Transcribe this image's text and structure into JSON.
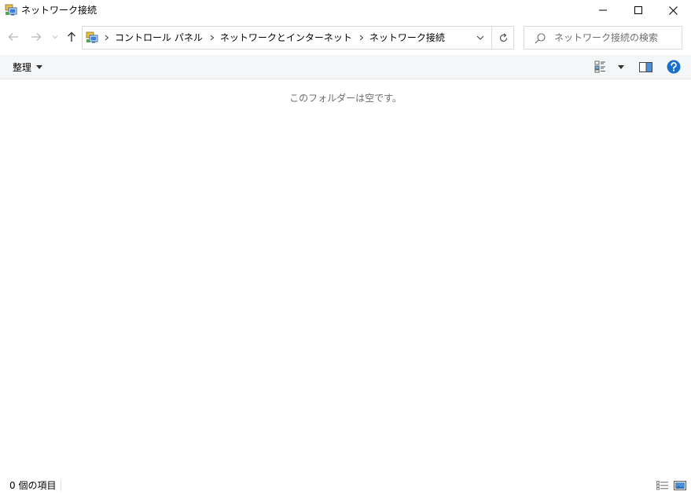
{
  "window": {
    "title": "ネットワーク接続",
    "app_icon": "network-connections-icon",
    "controls": {
      "minimize_icon": "minimize-icon",
      "maximize_icon": "maximize-icon",
      "close_icon": "close-icon"
    }
  },
  "navigation": {
    "back_icon": "arrow-left-icon",
    "forward_icon": "arrow-right-icon",
    "recent_icon": "chevron-down-icon",
    "up_icon": "arrow-up-icon",
    "breadcrumbs": [
      "コントロール パネル",
      "ネットワークとインターネット",
      "ネットワーク接続"
    ],
    "refresh_icon": "refresh-icon"
  },
  "search": {
    "placeholder": "ネットワーク接続の検索"
  },
  "commandbar": {
    "organize_label": "整理",
    "view_icon": "change-view-icon",
    "preview_pane_icon": "preview-pane-icon",
    "help_icon": "help-icon"
  },
  "content": {
    "empty_message": "このフォルダーは空です。"
  },
  "statusbar": {
    "item_count": "0 個の項目",
    "details_view_icon": "details-view-icon",
    "large_icons_view_icon": "large-icons-view-icon"
  },
  "colors": {
    "accent": "#0067c0",
    "help": "#1a6fc9",
    "muted_text": "#6d6d6d",
    "border": "#d9d9d9",
    "toolbar_bg": "#f5f6f7"
  }
}
